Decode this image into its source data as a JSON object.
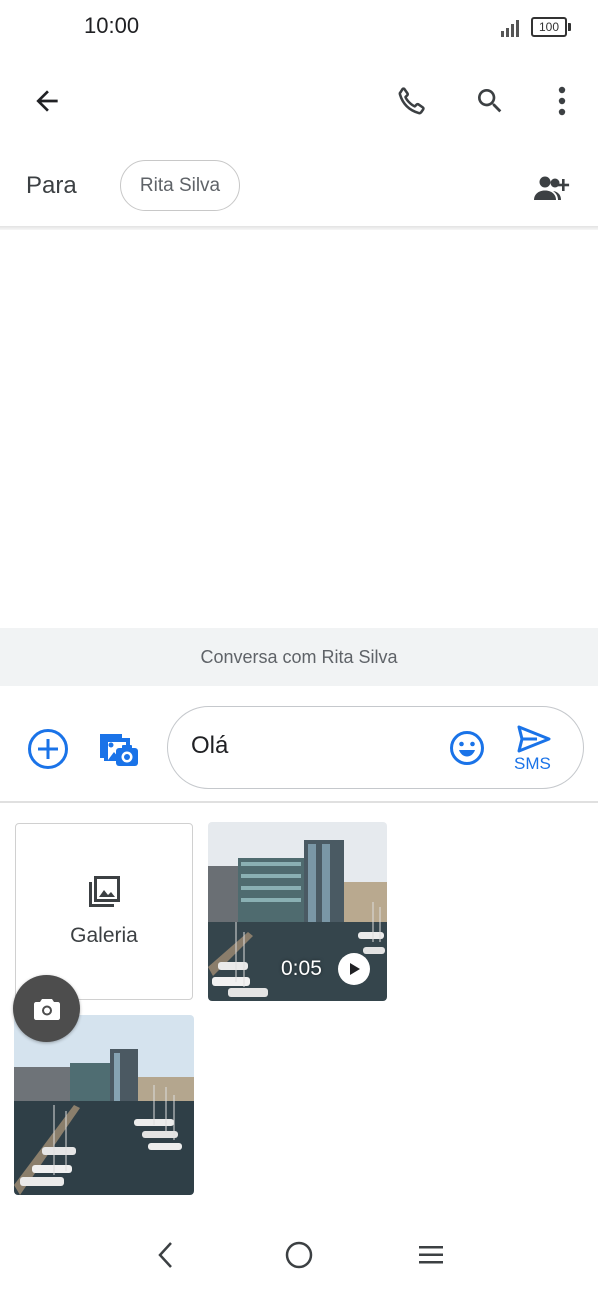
{
  "status_bar": {
    "time": "10:00",
    "battery": "100"
  },
  "recipient": {
    "to_label": "Para",
    "chip_name": "Rita Silva"
  },
  "conversation_banner": "Conversa com Rita Silva",
  "compose": {
    "text": "Olá",
    "send_type_label": "SMS"
  },
  "media_picker": {
    "gallery_label": "Galeria",
    "video_duration": "0:05"
  },
  "colors": {
    "accent": "#1a73e8",
    "icon_dark": "#3c4043"
  },
  "icons": [
    "back-icon",
    "phone-icon",
    "search-icon",
    "more-vert-icon",
    "add-person-icon",
    "add-circle-icon",
    "gallery-camera-icon",
    "emoji-icon",
    "send-icon",
    "gallery-icon",
    "play-icon",
    "camera-icon",
    "nav-back-icon",
    "nav-home-icon",
    "nav-recents-icon"
  ]
}
